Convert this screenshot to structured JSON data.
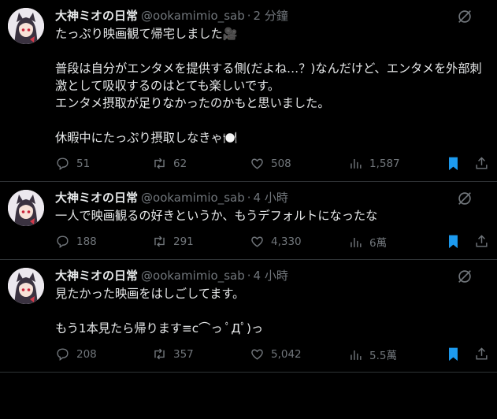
{
  "tweets": [
    {
      "name": "大神ミオの日常",
      "handle": "@ookamimio_sab",
      "dot": "·",
      "time": "2 分鐘",
      "text": "たっぷり映画観て帰宅しました🎥\n\n普段は自分がエンタメを提供する側(だよね…？)なんだけど、エンタメを外部刺激として吸収するのはとても楽しいです。\nエンタメ摂取が足りなかったのかもと思いました。\n\n休暇中にたっぷり摂取しなきゃ🍽️",
      "replies": "51",
      "retweets": "62",
      "likes": "508",
      "views": "1,587",
      "bookmarked": true
    },
    {
      "name": "大神ミオの日常",
      "handle": "@ookamimio_sab",
      "dot": "·",
      "time": "4 小時",
      "text": "一人で映画観るの好きというか、もうデフォルトになったな",
      "replies": "188",
      "retweets": "291",
      "likes": "4,330",
      "views": "6萬",
      "bookmarked": true
    },
    {
      "name": "大神ミオの日常",
      "handle": "@ookamimio_sab",
      "dot": "·",
      "time": "4 小時",
      "text": "見たかった映画をはしごしてます。\n\nもう1本見たら帰ります≡c⌒っ ﾟДﾟ)っ",
      "replies": "208",
      "retweets": "357",
      "likes": "5,042",
      "views": "5.5萬",
      "bookmarked": true
    }
  ],
  "icons": {
    "reply": "reply-icon",
    "retweet": "retweet-icon",
    "like": "heart-icon",
    "views": "views-icon",
    "bookmark": "bookmark-icon",
    "share": "share-icon",
    "grok": "grok-icon"
  },
  "colors": {
    "background": "#000000",
    "text": "#e7e9ea",
    "secondary": "#71767b",
    "accent": "#1d9bf0",
    "divider": "#2f3336"
  }
}
